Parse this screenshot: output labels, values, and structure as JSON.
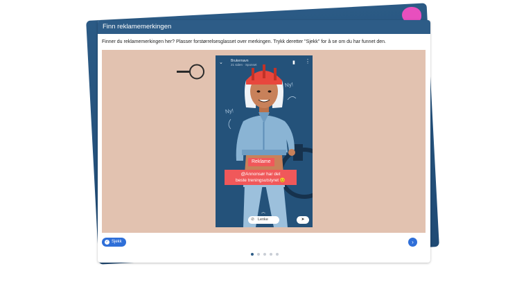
{
  "card": {
    "title": "Finn reklamemerkingen",
    "instruction": "Finner du reklamemerkingen her? Plasser forstørrelsesglasset over merkingen. Trykk deretter \"Sjekk\" for å se om du har funnet den."
  },
  "phone": {
    "username": "Brukernavn",
    "meta": "21 siden · Sponset",
    "annotation_left": "Ny!",
    "annotation_right": "Ny!",
    "ad_label": "Reklame",
    "ad_text_line1": "@Annonsør har det",
    "ad_text_line2": "beste treningsutstyret 😊",
    "link_label": "Lenke"
  },
  "controls": {
    "check_label": "Sjekk",
    "dots_total": 5,
    "dots_active": 1
  },
  "colors": {
    "header": "#2d5c87",
    "stage": "#e2c2b0",
    "phone_bg": "#24527a",
    "ad_red": "#f0585a",
    "button_blue": "#2f6fd8"
  }
}
